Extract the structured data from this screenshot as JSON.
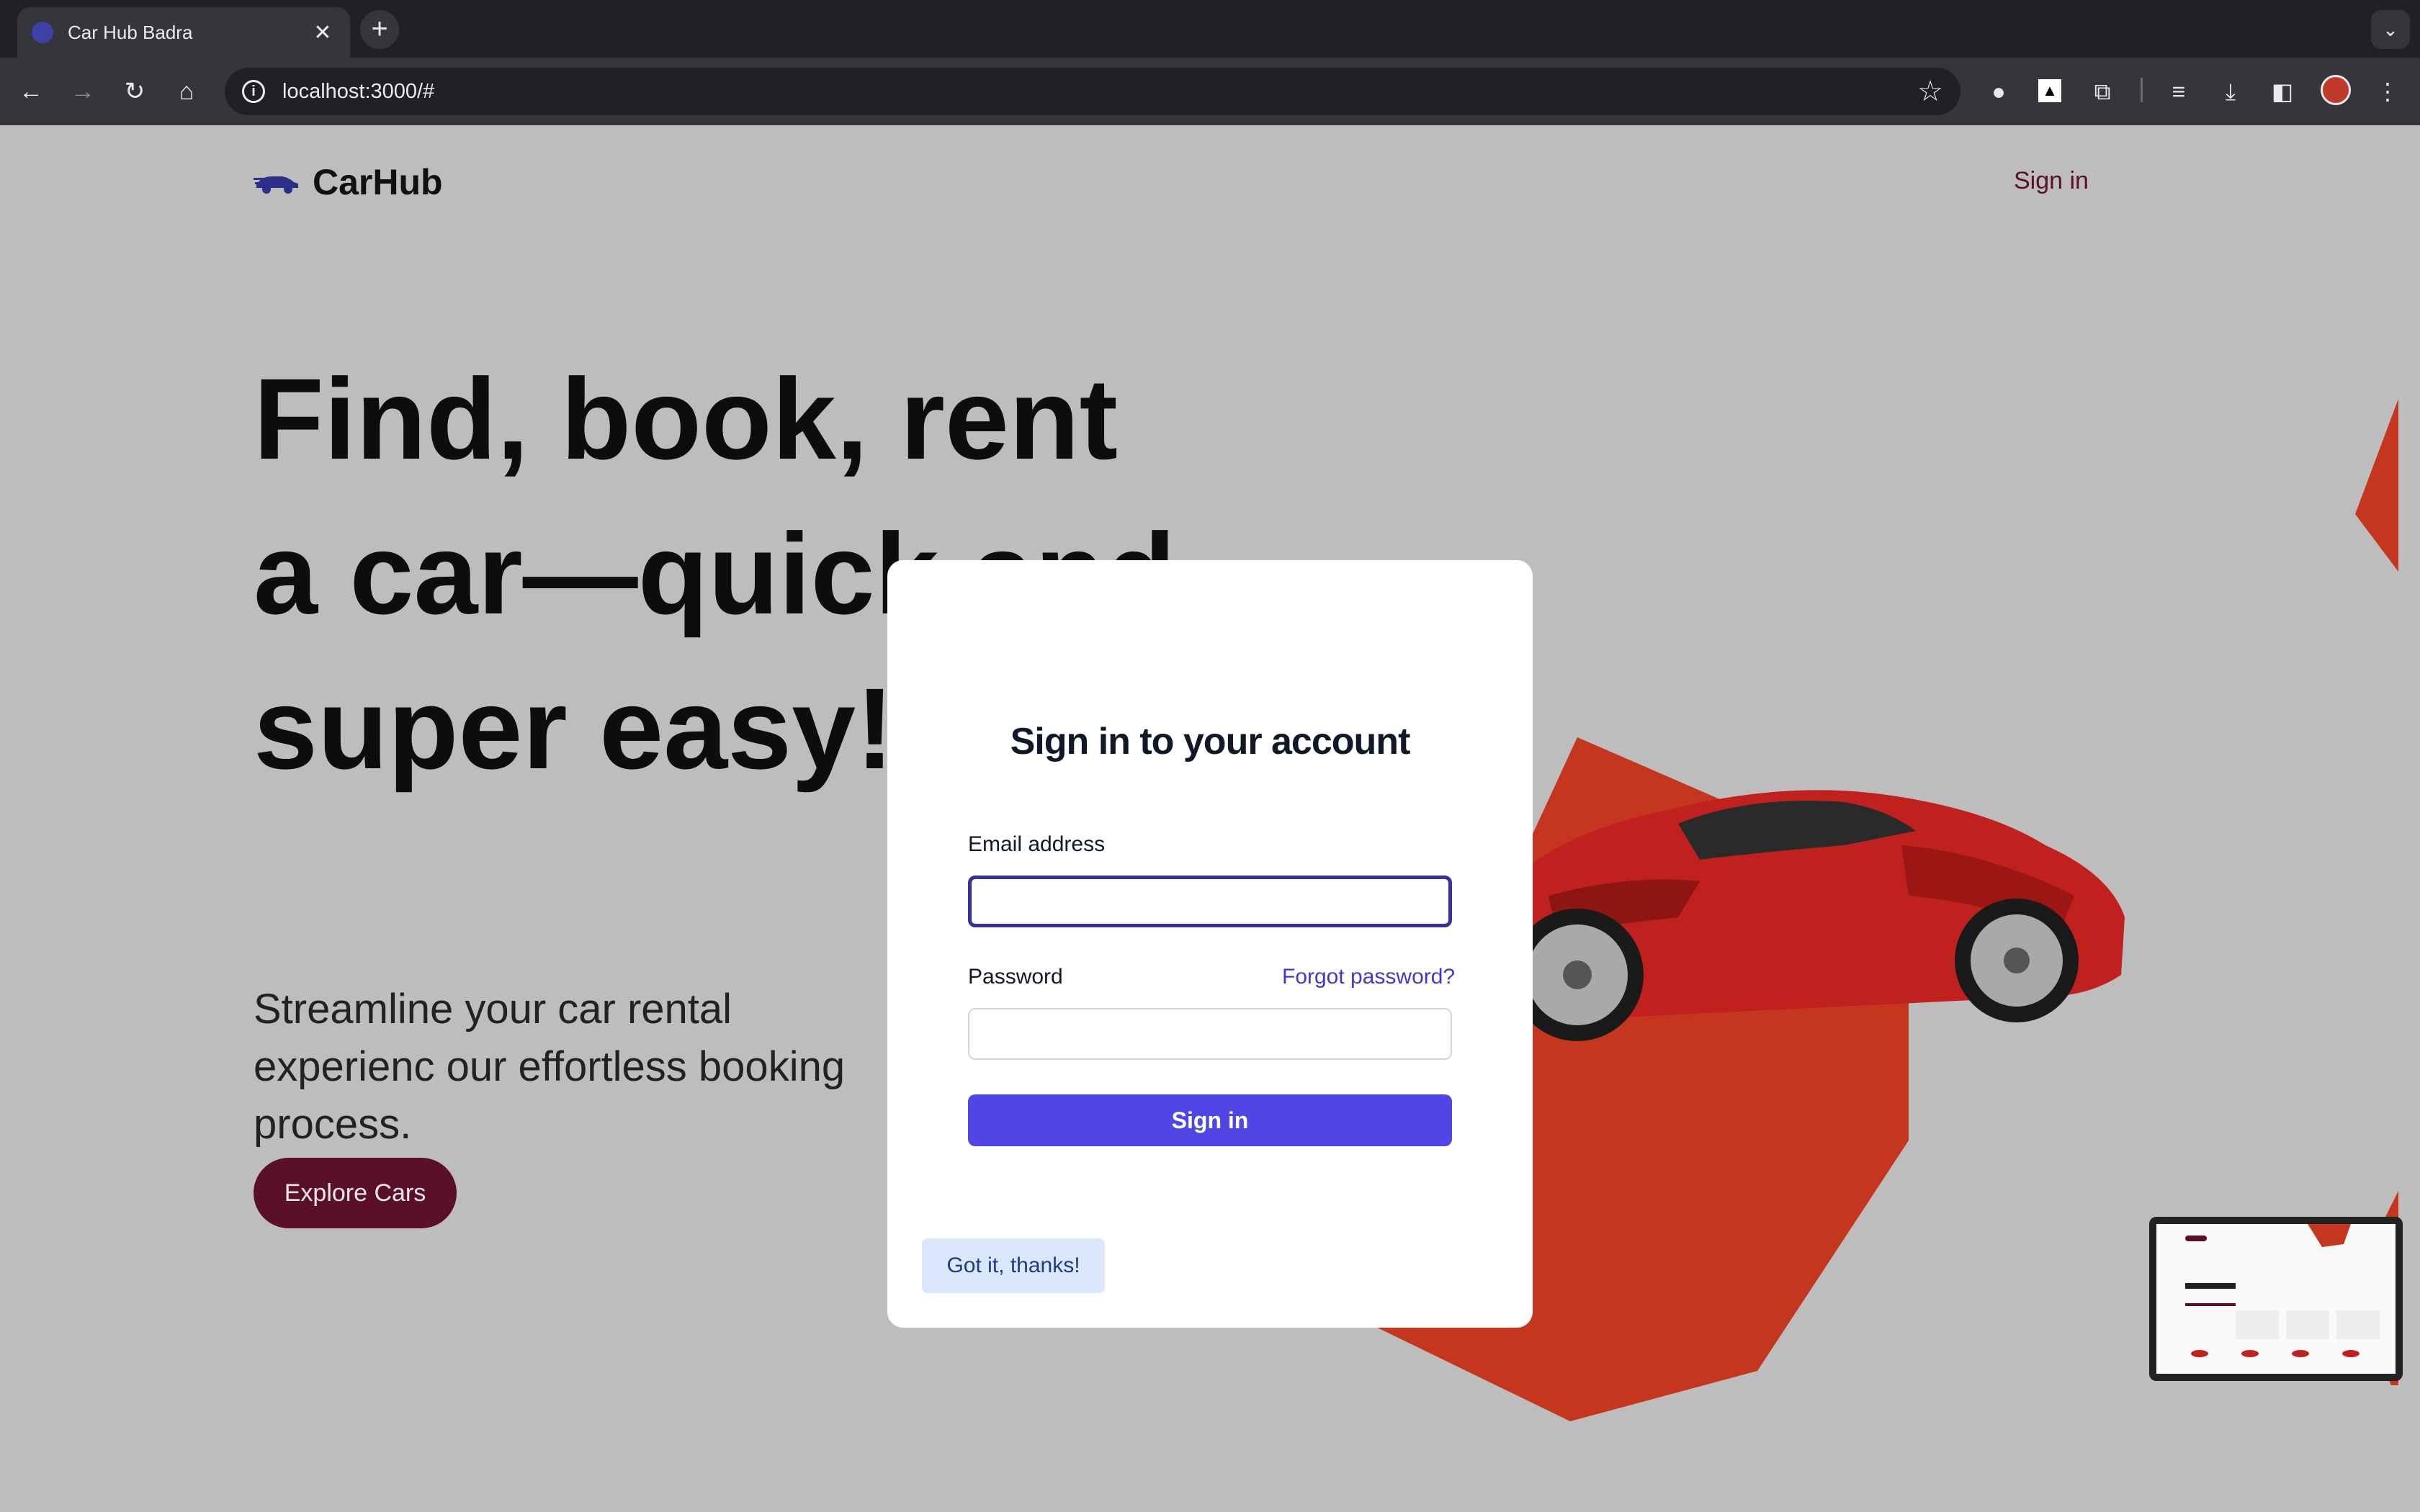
{
  "browser": {
    "tab_title": "Car Hub Badra",
    "tab_close": "✕",
    "new_tab": "+",
    "tab_search": "⌄",
    "url": "localhost:3000/#",
    "icons": [
      "back-icon",
      "forward-icon",
      "reload-icon",
      "home-icon",
      "info-icon",
      "star-icon",
      "extension-icon",
      "puzzle-icon",
      "media-icon",
      "download-icon",
      "sidepanel-icon",
      "menu-icon"
    ]
  },
  "header": {
    "logo_text": "CarHub",
    "signin_link": "Sign in"
  },
  "hero": {
    "title": "Find, book, rent a car—quick and super easy!",
    "subtitle": "Streamline your car rental experienc our effortless booking process.",
    "explore_button": "Explore Cars"
  },
  "modal": {
    "title": "Sign in to your account",
    "email_label": "Email address",
    "email_value": "",
    "password_label": "Password",
    "password_value": "",
    "forgot_link": "Forgot password?",
    "submit_button": "Sign in",
    "dismiss_button": "Got it, thanks!"
  },
  "colors": {
    "brand_maroon": "#5a1028",
    "accent_indigo": "#4f46e5",
    "hexagon_red": "#c5361e",
    "background": "#bdbdbd"
  }
}
